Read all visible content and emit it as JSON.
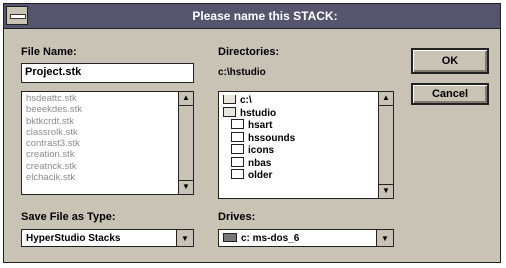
{
  "dialog": {
    "title": "Please name this STACK:",
    "file_name_label": "File Name:",
    "file_name_value": "Project.stk",
    "directories_label": "Directories:",
    "current_directory": "c:\\hstudio",
    "save_type_label": "Save File as Type:",
    "save_type_value": "HyperStudio Stacks",
    "drives_label": "Drives:",
    "drive_value": "c: ms-dos_6"
  },
  "files": [
    "hsdeattc.stk",
    "beeekdes.stk",
    "bktkcrdt.stk",
    "classrolk.stk",
    "contrast3.stk",
    "creation.stk",
    "creatnck.stk",
    "elchacik.stk"
  ],
  "directories": [
    {
      "name": "c:\\",
      "icon": "folder-open-icon"
    },
    {
      "name": "hstudio",
      "icon": "folder-open-icon"
    },
    {
      "name": "hsart",
      "icon": "folder-icon"
    },
    {
      "name": "hssounds",
      "icon": "folder-icon"
    },
    {
      "name": "icons",
      "icon": "folder-icon"
    },
    {
      "name": "nbas",
      "icon": "folder-icon"
    },
    {
      "name": "older",
      "icon": "folder-icon"
    }
  ],
  "buttons": {
    "ok": "OK",
    "cancel": "Cancel"
  },
  "colors": {
    "face": "#c9c3b6",
    "titlebar": "#55556e",
    "field": "#ffffff"
  }
}
